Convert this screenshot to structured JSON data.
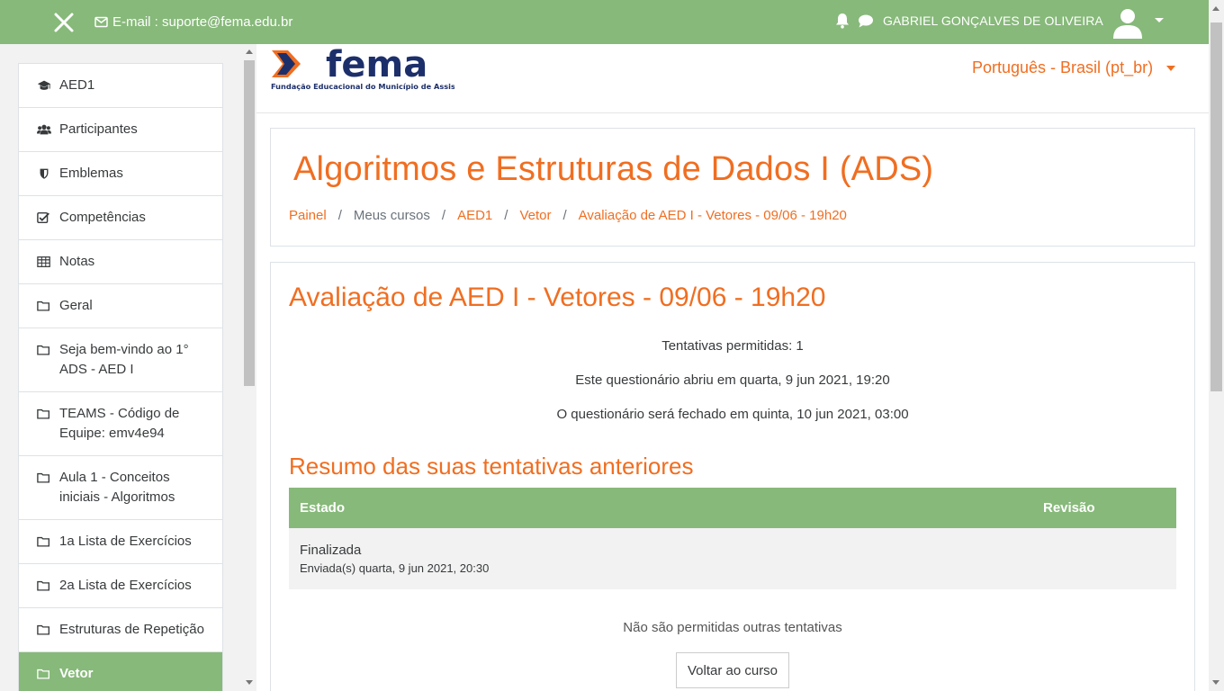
{
  "topbar": {
    "email": "E-mail : suporte@fema.edu.br",
    "username": "GABRIEL GONÇALVES DE OLIVEIRA"
  },
  "colors": {
    "accent_green": "#87b97a",
    "accent_orange": "#f06e21",
    "logo_blue": "#1d2f6b"
  },
  "logo": {
    "name": "fema",
    "subtitle": "Fundação Educacional do Município de Assis"
  },
  "language": "Português - Brasil (pt_br)",
  "sidebar": {
    "items": [
      {
        "label": "AED1",
        "icon": "graduation-cap-icon"
      },
      {
        "label": "Participantes",
        "icon": "users-icon"
      },
      {
        "label": "Emblemas",
        "icon": "shield-icon"
      },
      {
        "label": "Competências",
        "icon": "checkbox-icon"
      },
      {
        "label": "Notas",
        "icon": "table-icon"
      },
      {
        "label": "Geral",
        "icon": "folder-icon"
      },
      {
        "label": "Seja bem-vindo ao 1° ADS - AED I",
        "icon": "folder-icon"
      },
      {
        "label": "TEAMS - Código de Equipe: emv4e94",
        "icon": "folder-icon"
      },
      {
        "label": "Aula 1 - Conceitos iniciais - Algoritmos",
        "icon": "folder-icon"
      },
      {
        "label": "1a Lista de Exercícios",
        "icon": "folder-icon"
      },
      {
        "label": "2a Lista de Exercícios",
        "icon": "folder-icon"
      },
      {
        "label": "Estruturas de Repetição",
        "icon": "folder-icon"
      },
      {
        "label": "Vetor",
        "icon": "folder-icon",
        "active": true
      }
    ]
  },
  "course": {
    "title": "Algoritmos e Estruturas de Dados I (ADS)",
    "breadcrumb": [
      "Painel",
      "Meus cursos",
      "AED1",
      "Vetor",
      "Avaliação de AED I - Vetores - 09/06 - 19h20"
    ]
  },
  "quiz": {
    "title": "Avaliação de AED I - Vetores - 09/06 - 19h20",
    "attempts_allowed": "Tentativas permitidas: 1",
    "opened": "Este questionário abriu em quarta, 9 jun 2021, 19:20",
    "closes": "O questionário será fechado em quinta, 10 jun 2021, 03:00",
    "summary_title": "Resumo das suas tentativas anteriores",
    "table": {
      "headers": [
        "Estado",
        "Revisão"
      ],
      "rows": [
        {
          "state": "Finalizada",
          "submitted": "Enviada(s) quarta, 9 jun 2021, 20:30"
        }
      ]
    },
    "no_more": "Não são permitidas outras tentativas",
    "back_button": "Voltar ao curso"
  }
}
